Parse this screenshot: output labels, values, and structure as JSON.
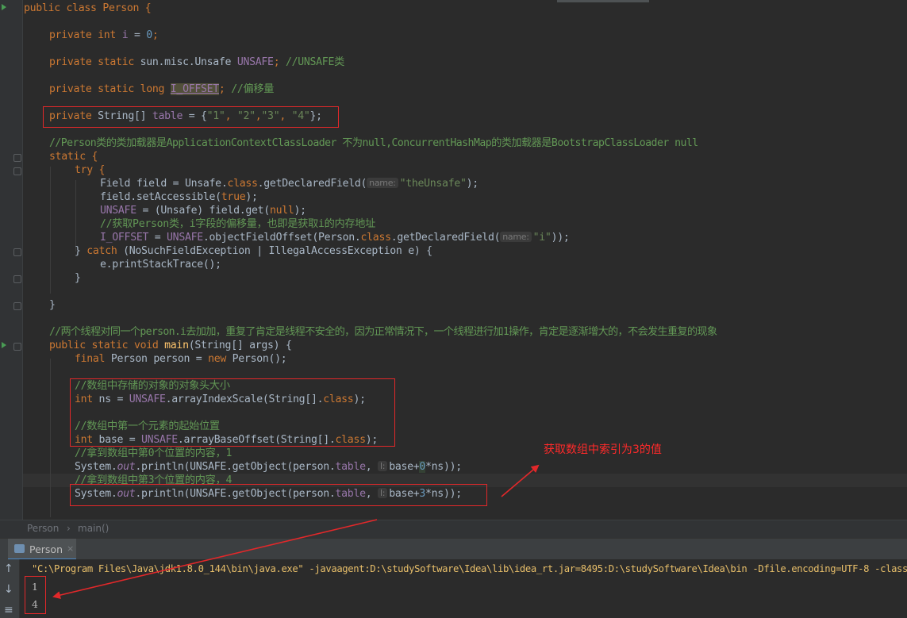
{
  "code": {
    "class_decl": "public class Person {",
    "field_i": {
      "kw": "private int",
      "name": "i",
      "rest": " = ",
      "value": "0",
      "end": ";"
    },
    "field_unsafe": {
      "kw": "private static",
      "type": " sun.misc.Unsafe ",
      "name": "UNSAFE",
      "end": "; ",
      "comment": "//UNSAFE类"
    },
    "field_offset": {
      "kw": "private static long",
      "name": "I_OFFSET",
      "end": "; ",
      "comment": "//偏移量"
    },
    "field_table": {
      "kw": "private",
      "type": " String[] ",
      "name": "table",
      "rest": " = {",
      "v1": "\"1\"",
      "v2": "\"2\"",
      "v3": "\"3\"",
      "v4": "\"4\"",
      "end": "};"
    },
    "comment_classloader": "//Person类的类加载器是ApplicationContextClassLoader 不为null,ConcurrentHashMap的类加载器是BootstrapClassLoader null",
    "static_block": "static {",
    "try_open": "try {",
    "field_decl": {
      "type": "Field",
      "rest": " field = ",
      "cls": "Unsafe",
      "dot": ".",
      "kwclass": "class",
      "method": ".getDeclaredField(",
      "hint": "name:",
      "arg": "\"theUnsafe\"",
      "end": ");"
    },
    "set_accessible": {
      "obj": "field",
      "method": ".setAccessible(",
      "arg": "true",
      "end": ");"
    },
    "unsafe_assign": {
      "name": "UNSAFE",
      "rest": " = (",
      "cls": "Unsafe",
      "rest2": ") field.",
      "method": "get(",
      "arg": "null",
      "end": ");"
    },
    "comment_get_offset": "//获取Person类，i字段的偏移量，也即是获取i的内存地址",
    "offset_assign": {
      "name": "I_OFFSET",
      "rest": " = ",
      "obj": "UNSAFE",
      "method": ".objectFieldOffset(",
      "cls": "Person",
      "dot": ".",
      "kwclass": "class",
      "method2": ".getDeclaredField(",
      "hint": "name:",
      "arg": "\"i\"",
      "end": "));"
    },
    "catch_line": {
      "close": "} ",
      "kw": "catch",
      "open": " (",
      "ex1": "NoSuchFieldException",
      "bar": " | ",
      "ex2": "IllegalAccessException",
      "rest": " e) {"
    },
    "print_trace": {
      "obj": "e.",
      "method": "printStackTrace",
      "end": "();"
    },
    "close_brace": "}",
    "comment_threads": "//两个线程对同一个person.i去加加，重复了肯定是线程不安全的，因为正常情况下，一个线程进行加1操作，肯定是逐渐增大的，不会发生重复的现象",
    "main_decl": {
      "kw": "public static void",
      "name": " main",
      "rest": "(String[] args) {"
    },
    "person_new": {
      "kw": "final",
      "type": " Person",
      "rest": " person = ",
      "kwnew": "new",
      "rest2": " Person();"
    },
    "comment_scale": "//数组中存储的对象的对象头大小",
    "scale_line": {
      "kw": "int",
      "rest": " ns = ",
      "obj": "UNSAFE",
      "method": ".arrayIndexScale(",
      "arg": "String[].",
      "kwclass": "class",
      "end": ");"
    },
    "comment_base": "//数组中第一个元素的起始位置",
    "base_line": {
      "kw": "int",
      "rest": " base = ",
      "obj": "UNSAFE",
      "method": ".arrayBaseOffset(",
      "arg": "String[].",
      "kwclass": "class",
      "end": ");"
    },
    "comment_idx0": "//拿到数组中第0个位置的内容，1",
    "print0": {
      "sys": "System.",
      "out": "out",
      "method": ".println(",
      "obj": "UNSAFE.getObject(person.",
      "field": "table",
      "comma": ", ",
      "hint": "l:",
      "expr1": "base+",
      "num": "0",
      "expr2": "*ns));"
    },
    "comment_idx3": "//拿到数组中第3个位置的内容，4",
    "print3": {
      "sys": "System.",
      "out": "out",
      "method": ".println(",
      "obj": "UNSAFE.getObject(person.",
      "field": "table",
      "comma": ", ",
      "hint": "l:",
      "expr1": "base+",
      "num": "3",
      "expr2": "*ns));"
    }
  },
  "annotation": "获取数组中索引为3的值",
  "breadcrumb": {
    "class": "Person",
    "sep": "›",
    "method": "main()"
  },
  "run_panel": {
    "tab_label": "Person",
    "close": "×",
    "command": "\"C:\\Program Files\\Java\\jdk1.8.0_144\\bin\\java.exe\" -javaagent:D:\\studySoftware\\Idea\\lib\\idea_rt.jar=8495:D:\\studySoftware\\Idea\\bin -Dfile.encoding=UTF-8 -class",
    "output": [
      "1",
      "4"
    ],
    "side_icons": [
      "↑",
      "↓",
      "≡"
    ]
  },
  "colors": {
    "editor_bg": "#2b2b2b",
    "keyword": "#cc7832",
    "string": "#6a8759",
    "comment": "#629755",
    "field": "#9876aa",
    "method": "#ffc66d",
    "annotation_red": "#e2282a"
  }
}
